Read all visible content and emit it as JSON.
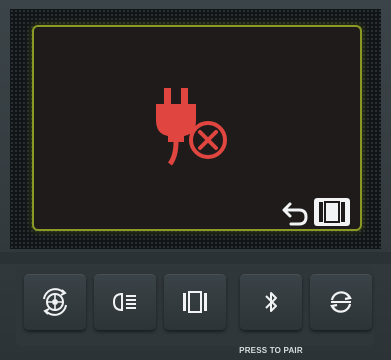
{
  "screen": {
    "status_icon": "unplugged-error-icon",
    "back_icon": "back-arrow-icon",
    "mode_icon": "camera-view-icon"
  },
  "buttons": [
    {
      "name": "tire-settings-button",
      "icon": "tire-rotate-icon"
    },
    {
      "name": "headlight-button",
      "icon": "headlight-icon"
    },
    {
      "name": "camera-view-button",
      "icon": "camera-view-icon"
    },
    {
      "name": "bluetooth-button",
      "icon": "bluetooth-icon"
    },
    {
      "name": "refresh-button",
      "icon": "refresh-icon"
    }
  ],
  "bluetooth_label": "PRESS TO PAIR",
  "colors": {
    "accent_red": "#e0463f",
    "frame_green": "#8a9a24",
    "icon_white": "#f1f3f4"
  }
}
